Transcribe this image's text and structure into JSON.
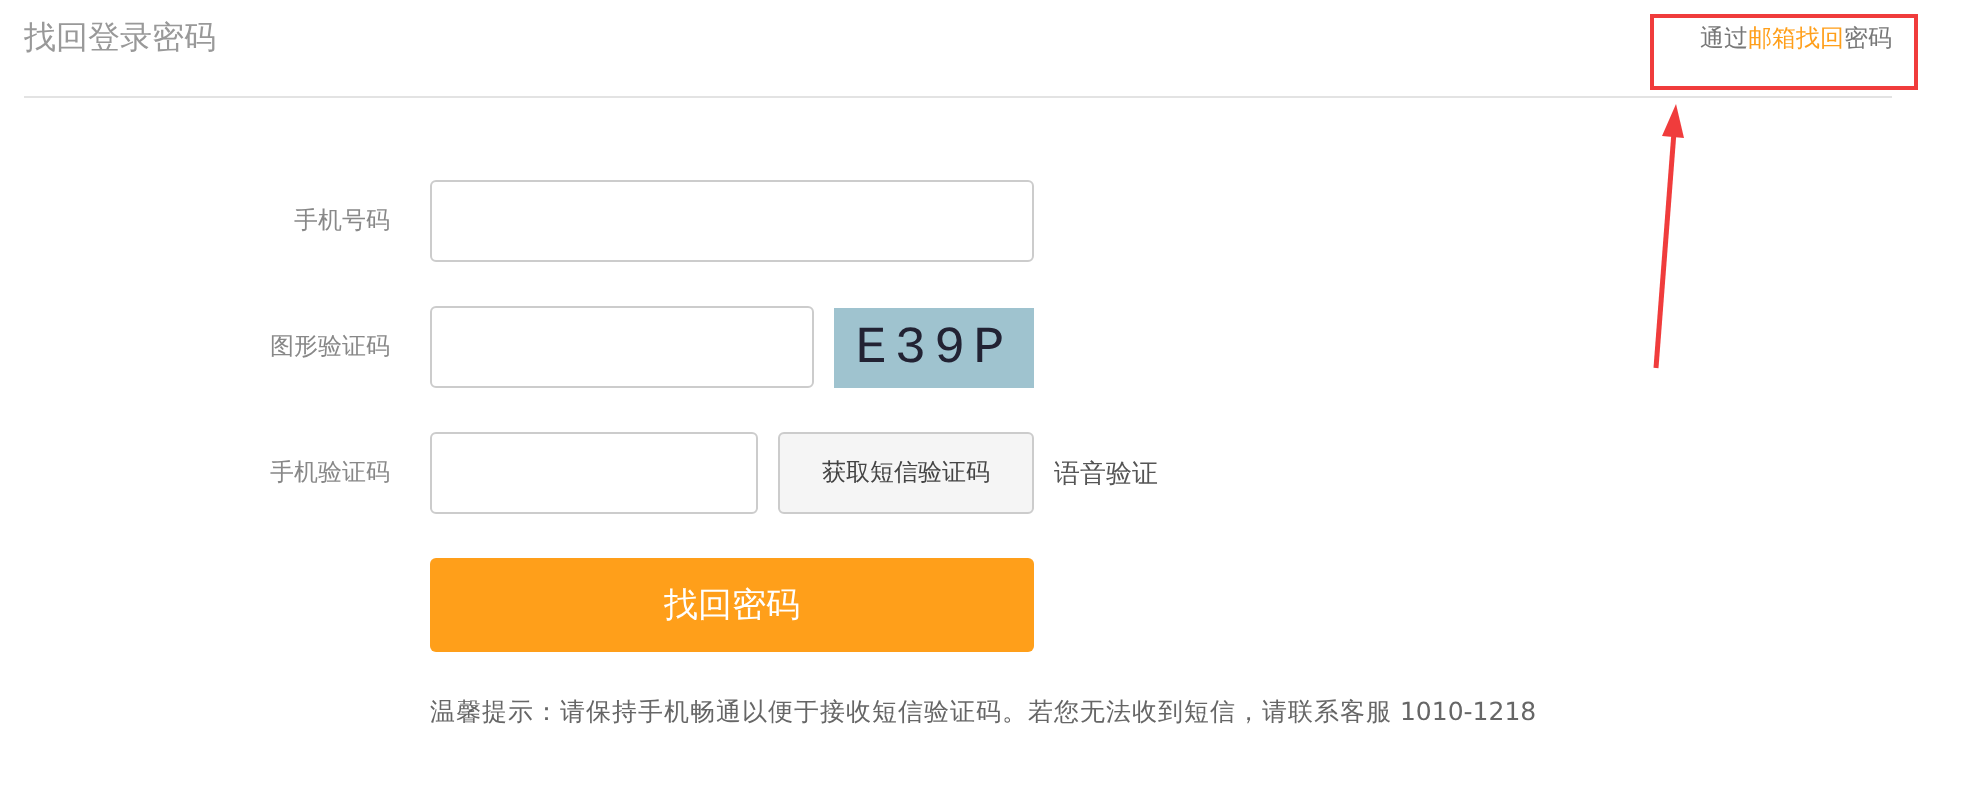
{
  "header": {
    "title": "找回登录密码",
    "switch_link": {
      "prefix": "通过",
      "link": "邮箱找回",
      "suffix": "密码"
    }
  },
  "fields": [
    {
      "kind": "input",
      "label": "手机号码"
    },
    {
      "kind": "captcha",
      "label": "图形验证码",
      "captcha": "E39P"
    },
    {
      "kind": "sms",
      "label": "手机验证码",
      "button": "获取短信验证码",
      "voice": "语音验证"
    }
  ],
  "submit": "找回密码",
  "tip": "温馨提示：请保持手机畅通以便于接收短信验证码。若您无法收到短信，请联系客服 1010-1218"
}
